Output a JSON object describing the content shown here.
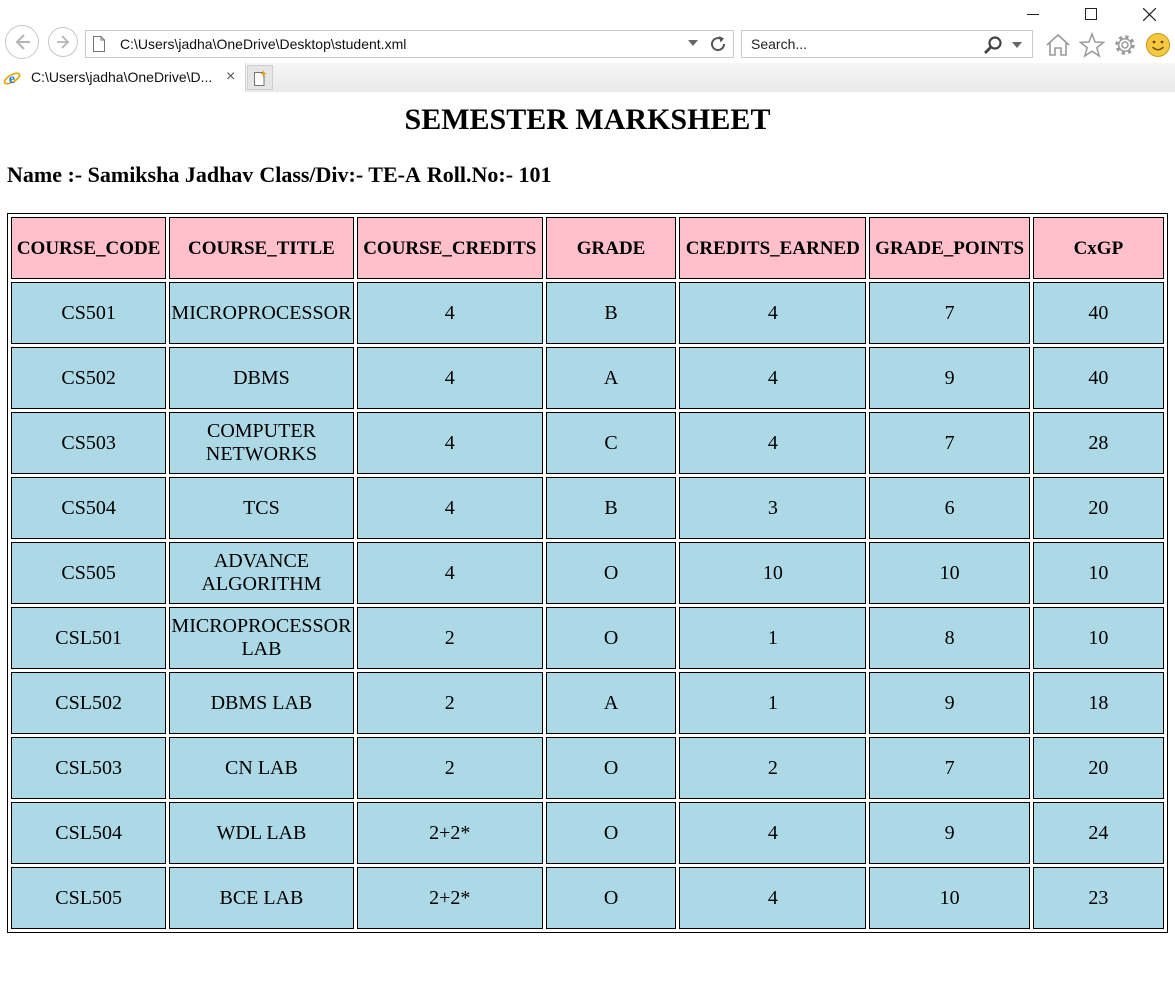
{
  "browser": {
    "address_url": "C:\\Users\\jadha\\OneDrive\\Desktop\\student.xml",
    "search_placeholder": "Search...",
    "tab_title": "C:\\Users\\jadha\\OneDrive\\D...",
    "tab_close": "×",
    "icons": [
      "back-icon",
      "forward-icon",
      "page-icon",
      "dropdown-icon",
      "refresh-icon",
      "search-icon",
      "home-icon",
      "favorites-star-icon",
      "settings-gear-icon",
      "smiley-feedback-icon",
      "ie-logo-icon",
      "new-tab-icon",
      "minimize-icon",
      "maximize-icon",
      "close-icon"
    ]
  },
  "page": {
    "title": "SEMESTER MARKSHEET",
    "student": {
      "name": "Name :- Samiksha Jadhav",
      "class_div": "Class/Div:- TE-A",
      "roll_no": "Roll.No:- 101"
    },
    "header_color": "#ffc0cb",
    "cell_color": "#add8e6",
    "columns": [
      "COURSE_CODE",
      "COURSE_TITLE",
      "COURSE_CREDITS",
      "GRADE",
      "CREDITS_EARNED",
      "GRADE_POINTS",
      "CxGP"
    ],
    "rows": [
      [
        "CS501",
        "MICROPROCESSOR",
        "4",
        "B",
        "4",
        "7",
        "40"
      ],
      [
        "CS502",
        "DBMS",
        "4",
        "A",
        "4",
        "9",
        "40"
      ],
      [
        "CS503",
        "COMPUTER NETWORKS",
        "4",
        "C",
        "4",
        "7",
        "28"
      ],
      [
        "CS504",
        "TCS",
        "4",
        "B",
        "3",
        "6",
        "20"
      ],
      [
        "CS505",
        "ADVANCE ALGORITHM",
        "4",
        "O",
        "10",
        "10",
        "10"
      ],
      [
        "CSL501",
        "MICROPROCESSOR LAB",
        "2",
        "O",
        "1",
        "8",
        "10"
      ],
      [
        "CSL502",
        "DBMS LAB",
        "2",
        "A",
        "1",
        "9",
        "18"
      ],
      [
        "CSL503",
        "CN LAB",
        "2",
        "O",
        "2",
        "7",
        "20"
      ],
      [
        "CSL504",
        "WDL LAB",
        "2+2*",
        "O",
        "4",
        "9",
        "24"
      ],
      [
        "CSL505",
        "BCE LAB",
        "2+2*",
        "O",
        "4",
        "10",
        "23"
      ]
    ]
  }
}
